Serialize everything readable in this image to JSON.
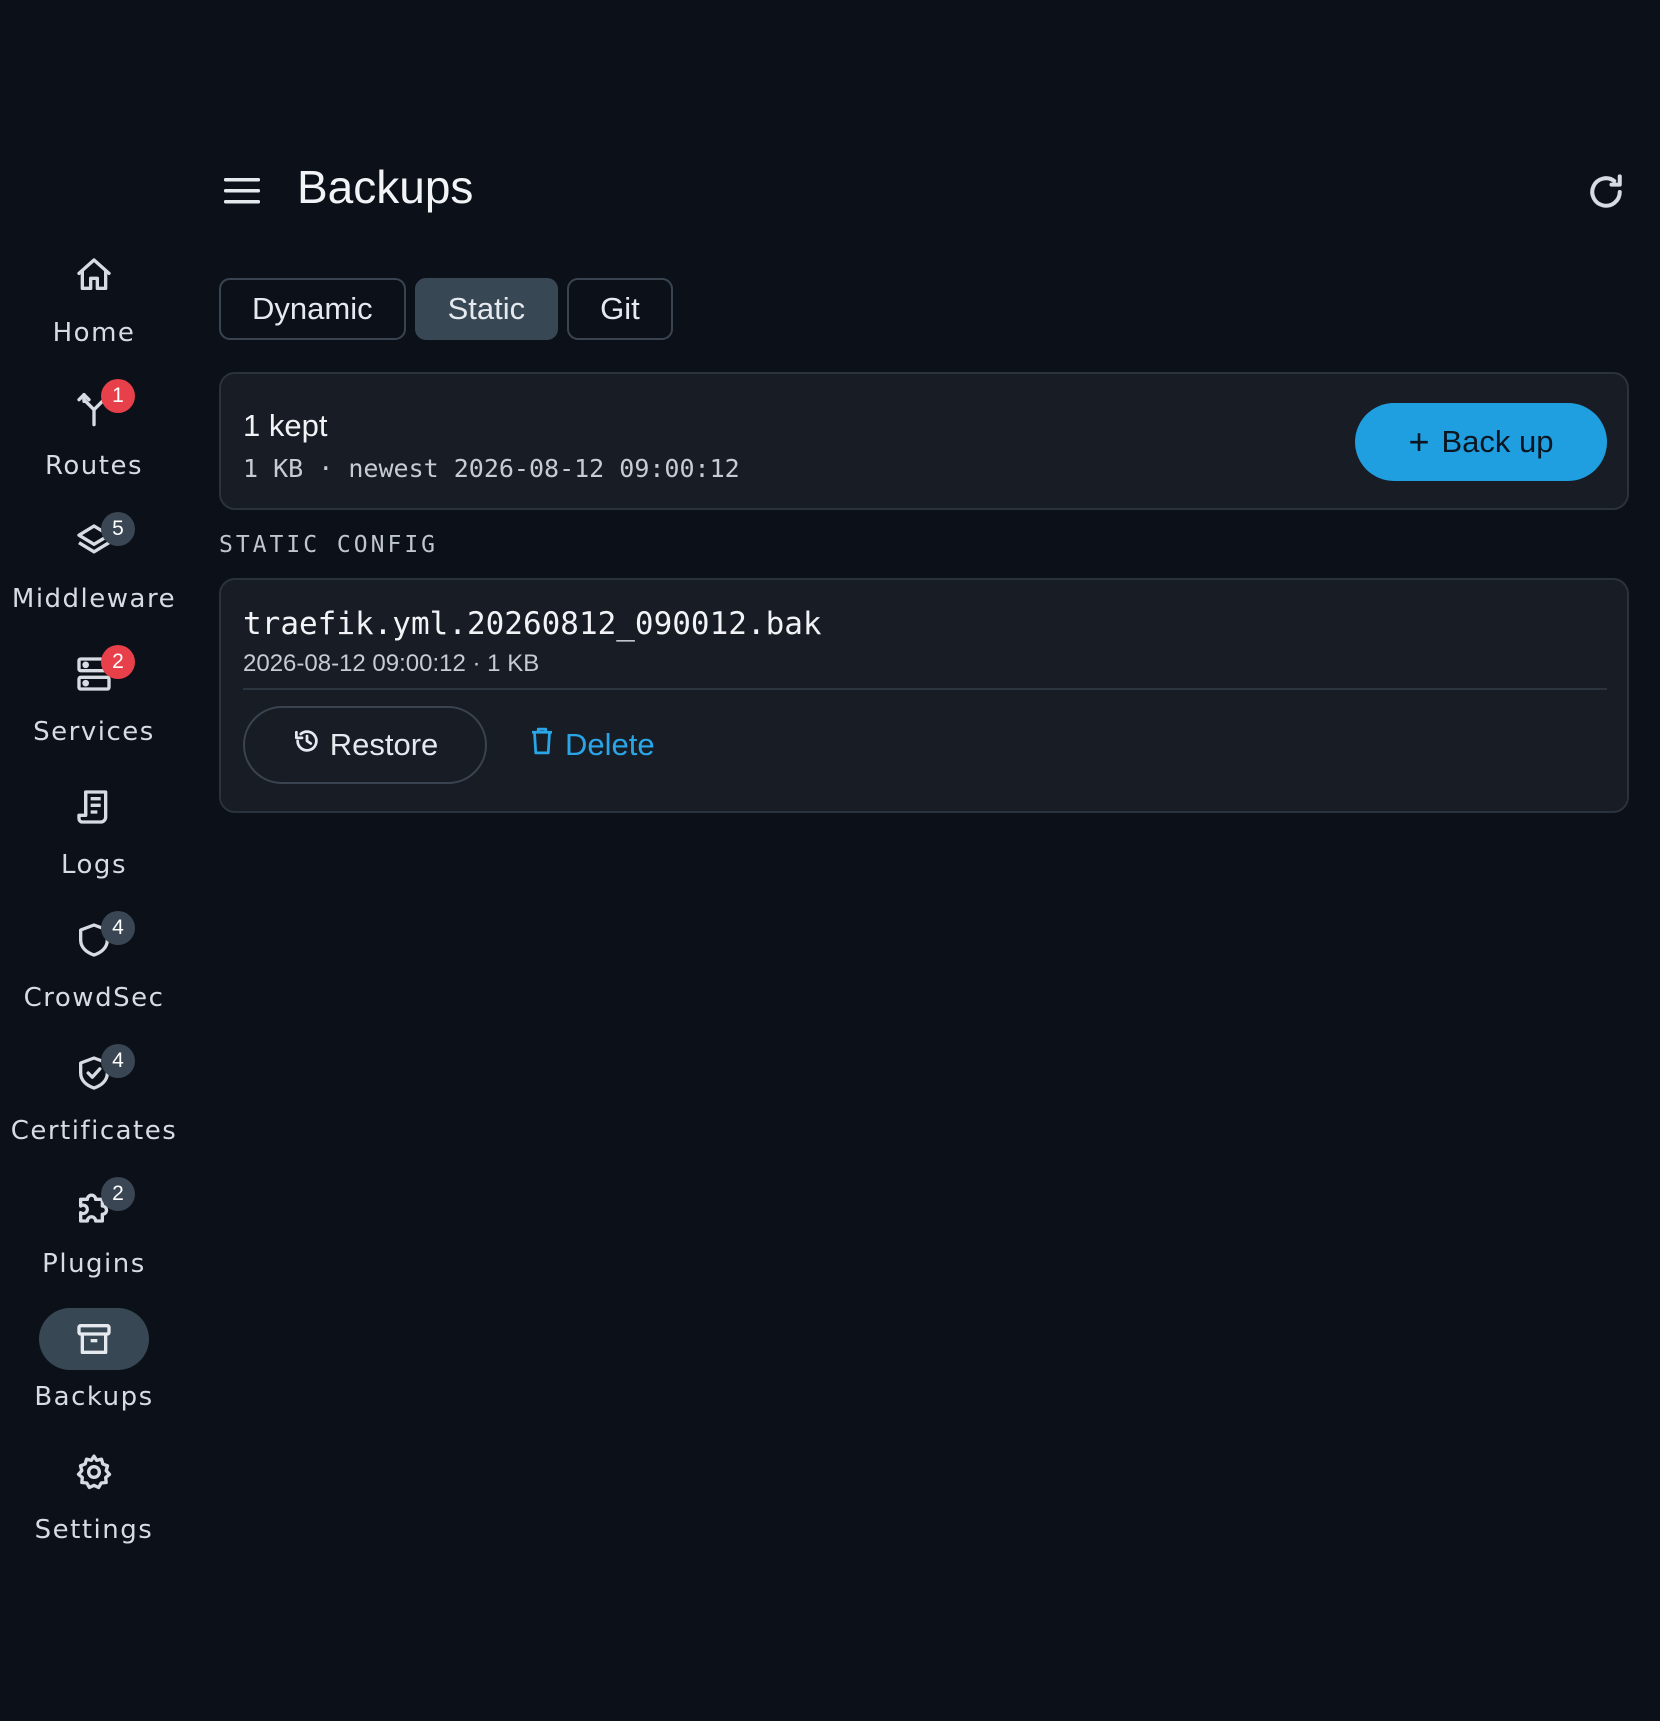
{
  "header": {
    "title": "Backups",
    "menu_icon": "hamburger-menu-icon",
    "refresh_icon": "refresh-icon"
  },
  "sidebar": {
    "items": [
      {
        "label": "Home",
        "icon": "home-icon",
        "badge": ""
      },
      {
        "label": "Routes",
        "icon": "routes-icon",
        "badge": "1",
        "badge_color": "#e8404a"
      },
      {
        "label": "Middleware",
        "icon": "layers-icon",
        "badge": "5",
        "badge_color": "#3a4653"
      },
      {
        "label": "Services",
        "icon": "server-icon",
        "badge": "2",
        "badge_color": "#e8404a"
      },
      {
        "label": "Logs",
        "icon": "logs-icon",
        "badge": ""
      },
      {
        "label": "CrowdSec",
        "icon": "shield-icon",
        "badge": "4",
        "badge_color": "#3a4653"
      },
      {
        "label": "Certificates",
        "icon": "shield-check-icon",
        "badge": "4",
        "badge_color": "#3a4653"
      },
      {
        "label": "Plugins",
        "icon": "puzzle-icon",
        "badge": "2",
        "badge_color": "#3a4653"
      },
      {
        "label": "Backups",
        "icon": "archive-icon",
        "badge": "",
        "active": true
      },
      {
        "label": "Settings",
        "icon": "gear-icon",
        "badge": ""
      }
    ]
  },
  "tabs": [
    {
      "label": "Dynamic",
      "active": false
    },
    {
      "label": "Static",
      "active": true
    },
    {
      "label": "Git",
      "active": false
    }
  ],
  "summary": {
    "count": "1 kept",
    "meta": "1 KB · newest 2026-08-12 09:00:12",
    "backup_button": "Back up",
    "backup_button_icon": "+"
  },
  "section": {
    "label": "STATIC CONFIG"
  },
  "backups": [
    {
      "name": "traefik.yml.20260812_090012.bak",
      "meta": "2026-08-12 09:00:12 · 1 KB",
      "restore_label": "Restore",
      "delete_label": "Delete"
    }
  ],
  "colors": {
    "background": "#0c1119",
    "card": "#171c25",
    "accent": "#1f9ee0",
    "link": "#2aa6e8",
    "active_nav": "#374754",
    "badge_red": "#e8404a",
    "badge_gray": "#3a4653"
  }
}
